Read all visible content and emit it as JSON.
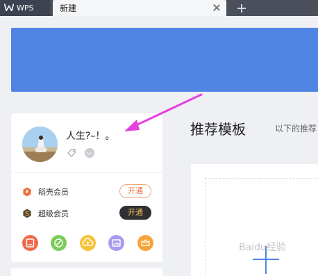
{
  "colors": {
    "tabbar": "#4a4f5b",
    "banner": "#5085e3",
    "accent_blue": "#4f86e8",
    "arrow": "#e63fe0",
    "open_outline": "#e8744a",
    "open_dark_text": "#f5c15a"
  },
  "tabs": [
    {
      "label": "WPS",
      "icon": "wps-logo-icon"
    },
    {
      "label": "新建",
      "icon": "close-icon"
    }
  ],
  "user": {
    "name": "人生?–！。",
    "avatar": "avatar-photo"
  },
  "membership": [
    {
      "label": "稻壳会员",
      "icon": "docer-icon",
      "button": "开通"
    },
    {
      "label": "超级会员",
      "icon": "super-vip-icon",
      "button": "开通"
    }
  ],
  "app_icons": [
    "picture-app-icon",
    "ban-app-icon",
    "cloud-app-icon",
    "image-app-icon",
    "crown-app-icon"
  ],
  "main": {
    "title": "推荐模板",
    "subtitle": "以下的推荐"
  },
  "watermark": "Baidu经验"
}
